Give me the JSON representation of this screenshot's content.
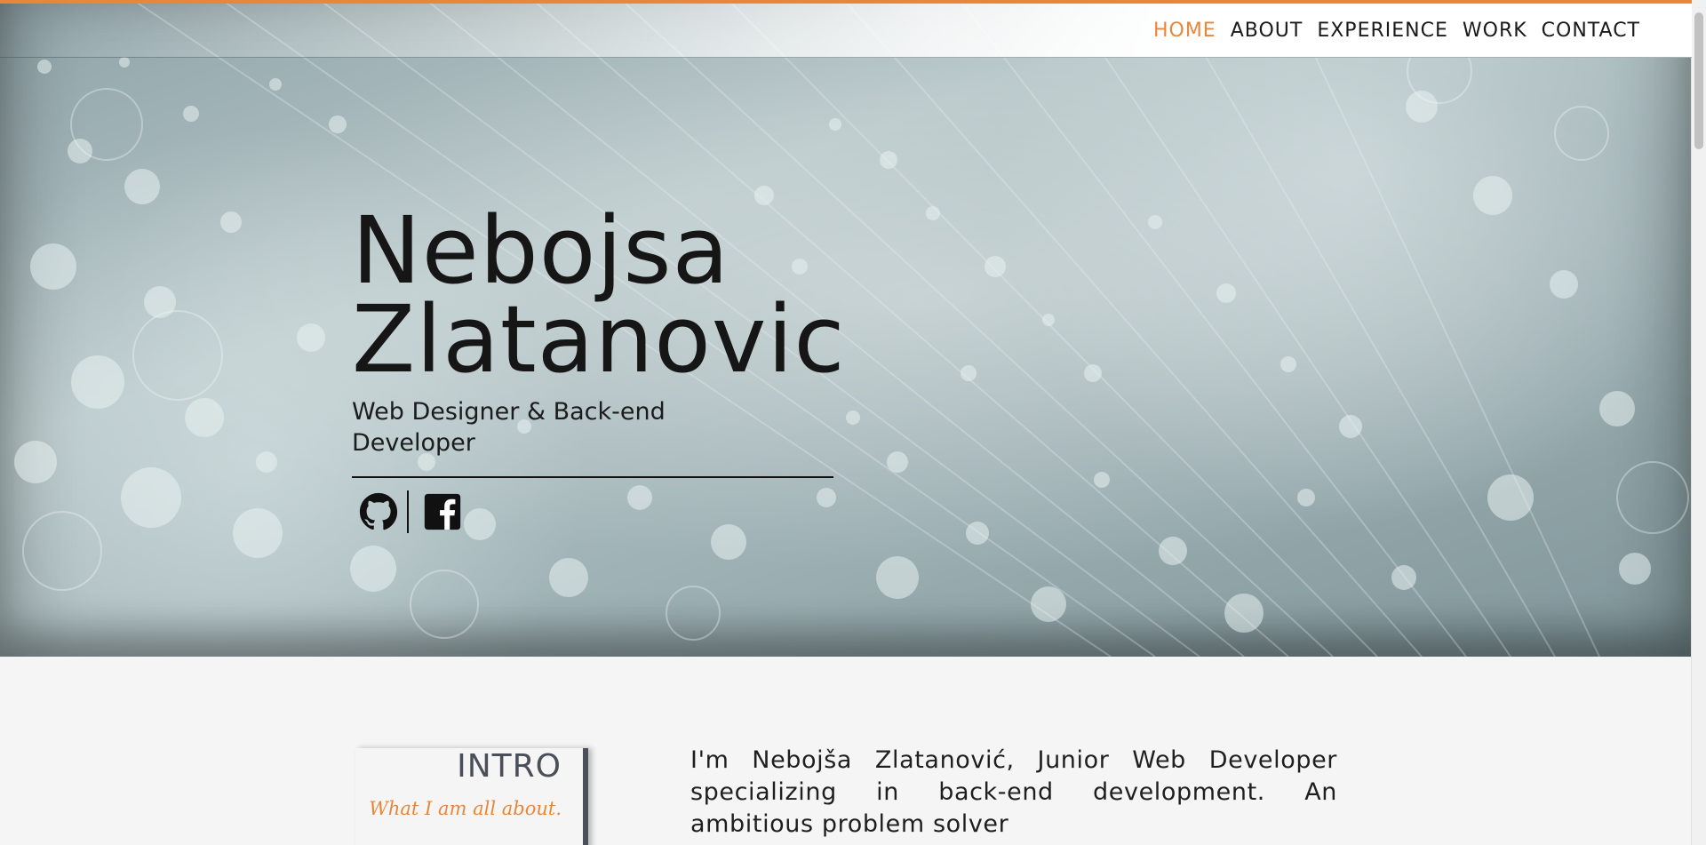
{
  "nav": {
    "items": [
      {
        "label": "HOME",
        "active": true
      },
      {
        "label": "ABOUT",
        "active": false
      },
      {
        "label": "EXPERIENCE",
        "active": false
      },
      {
        "label": "WORK",
        "active": false
      },
      {
        "label": "CONTACT",
        "active": false
      }
    ]
  },
  "hero": {
    "name": "Nebojsa Zlatanovic",
    "subtitle": "Web Designer & Back-end Developer",
    "social": [
      {
        "icon": "github-icon"
      },
      {
        "icon": "facebook-icon"
      }
    ]
  },
  "intro": {
    "title": "INTRO",
    "tagline": "What I am all about.",
    "body": "I'm Nebojša Zlatanović, Junior Web Developer specializing in back-end development. An ambitious problem solver"
  },
  "colors": {
    "accent": "#e8873a",
    "text_dark": "#161616",
    "heading_slate": "#4a4f5a",
    "page_bg": "#f5f5f5"
  }
}
